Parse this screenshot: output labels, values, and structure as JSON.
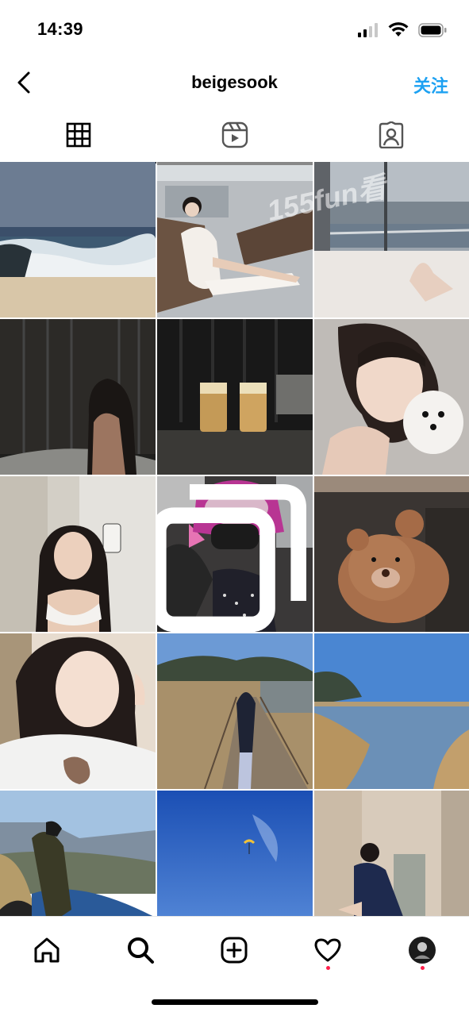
{
  "status_bar": {
    "time": "14:39"
  },
  "header": {
    "username": "beigesook",
    "follow_label": "关注"
  },
  "tabs": [
    {
      "name": "posts",
      "icon": "grid-icon",
      "active": true
    },
    {
      "name": "reels",
      "icon": "reels-icon",
      "active": false
    },
    {
      "name": "tagged",
      "icon": "tagged-user-icon",
      "active": false
    }
  ],
  "watermark": "155fun看",
  "posts": [
    {
      "subject": "ocean waves on beach",
      "colors": [
        "#5f7088",
        "#e6ebee"
      ]
    },
    {
      "subject": "woman in white dress on lounger",
      "colors": [
        "#b8bcc0",
        "#f4f2ee"
      ]
    },
    {
      "subject": "city bridge view from window",
      "colors": [
        "#9aa3ad",
        "#e8e4e0"
      ]
    },
    {
      "subject": "woman at night window",
      "colors": [
        "#20201e",
        "#5b4d42"
      ]
    },
    {
      "subject": "two glasses of beer",
      "colors": [
        "#1c1c1c",
        "#c9a463"
      ]
    },
    {
      "subject": "selfie with white puppy",
      "colors": [
        "#c7c3bf",
        "#e6d4c8"
      ]
    },
    {
      "subject": "mirror selfie",
      "colors": [
        "#cfcbc2",
        "#2b2622"
      ]
    },
    {
      "subject": "woman in pink bucket hat in car",
      "colors": [
        "#2e2c2d",
        "#b3348f"
      ]
    },
    {
      "subject": "teddy bear on sofa",
      "colors": [
        "#3b3633",
        "#b07b57"
      ]
    },
    {
      "subject": "smiling selfie with plush",
      "colors": [
        "#e7dccd",
        "#2a2120"
      ]
    },
    {
      "subject": "boardwalk through reeds",
      "colors": [
        "#5e8fce",
        "#a9916b"
      ]
    },
    {
      "subject": "lake with reeds",
      "colors": [
        "#3f7dcc",
        "#b99a6c"
      ]
    },
    {
      "subject": "hiker on mountain slope",
      "colors": [
        "#93b6d8",
        "#5d6133"
      ]
    },
    {
      "subject": "paraglider in blue sky",
      "colors": [
        "#1f53b6",
        "#7fa6e2"
      ]
    },
    {
      "subject": "woman sitting on floor mirror selfie",
      "colors": [
        "#d7cbbb",
        "#1f2a4c"
      ]
    }
  ],
  "bottom_nav": [
    {
      "name": "home",
      "icon": "home-icon",
      "dot": false
    },
    {
      "name": "search",
      "icon": "search-icon",
      "dot": false
    },
    {
      "name": "create",
      "icon": "add-post-icon",
      "dot": false
    },
    {
      "name": "activity",
      "icon": "heart-icon",
      "dot": true
    },
    {
      "name": "profile",
      "icon": "profile-avatar-icon",
      "dot": true
    }
  ]
}
